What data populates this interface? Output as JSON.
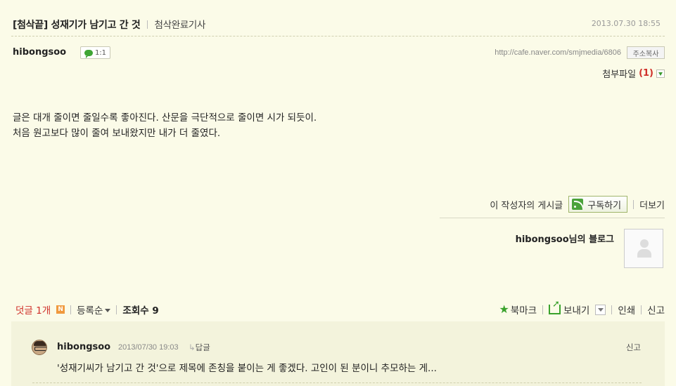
{
  "post": {
    "title": "[첨삭끝] 성재기가 남기고 간 것",
    "category": "첨삭완료기사",
    "date": "2013.07.30 18:55",
    "author": "hibongsoo",
    "chat_label": "1:1",
    "url": "http://cafe.naver.com/smjmedia/6806",
    "copy_label": "주소복사",
    "attach_label": "첨부파일",
    "attach_count": "(1)",
    "body_lines": [
      "글은 대개 줄이면 줄일수록 좋아진다. 산문을 극단적으로 줄이면 시가 되듯이.",
      "처음 원고보다 많이 줄여 보내왔지만 내가 더 줄였다."
    ]
  },
  "writer": {
    "posts_label": "이 작성자의 게시글",
    "subscribe_label": "구독하기",
    "more_label": "더보기",
    "blog_label": "hibongsoo님의 블로그"
  },
  "comments_bar": {
    "comments_label": "덧글 1개",
    "new_badge": "N",
    "sort_label": "등록순",
    "views_label": "조회수 9",
    "bookmark_label": "북마크",
    "send_label": "보내기",
    "print_label": "인쇄",
    "report_label": "신고"
  },
  "comment": {
    "author": "hibongsoo",
    "date": "2013/07/30 19:03",
    "reply_label": "답글",
    "report_label": "신고",
    "text": "'성재기씨가 남기고 간 것'으로 제목에 존칭을 붙이는 게 좋겠다. 고인이 된 분이니 추모하는 게..."
  },
  "colors": {
    "background": "#fbfbe8",
    "accent_red": "#d0302a",
    "accent_green": "#3aa22c",
    "comment_bg": "#f3f3dc"
  },
  "icons": [
    "chat-icon",
    "download-icon",
    "rss-icon",
    "new-badge",
    "star-icon",
    "send-icon",
    "dropdown-icon",
    "avatar",
    "profile-placeholder"
  ]
}
